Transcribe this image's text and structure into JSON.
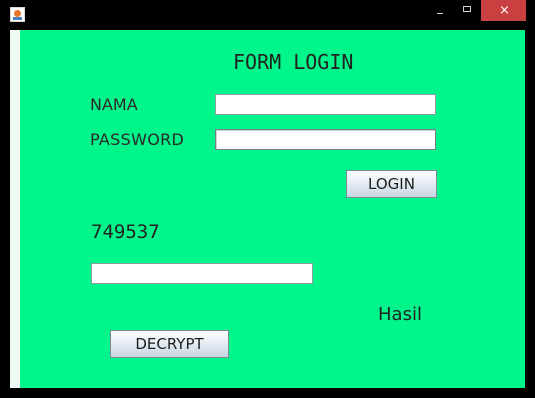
{
  "window": {
    "icon": "java-cup-icon",
    "controls": {
      "minimize": "minimize-icon",
      "maximize": "maximize-icon",
      "close": "×"
    }
  },
  "form": {
    "title": "FORM LOGIN",
    "nama_label": "NAMA",
    "nama_value": "",
    "password_label": "PASSWORD",
    "password_value": "",
    "login_button": "LOGIN",
    "number_value": "749537",
    "cipher_value": "",
    "hasil_label": "Hasil",
    "decrypt_button": "DECRYPT"
  },
  "colors": {
    "background": "#00f58a",
    "frame": "#000000",
    "close": "#c94040"
  }
}
